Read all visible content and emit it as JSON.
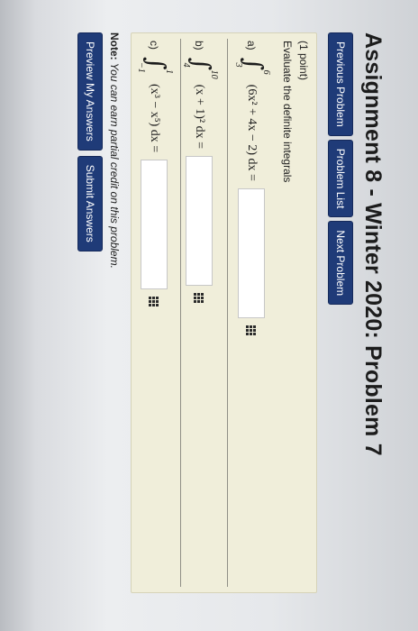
{
  "header": {
    "title": "Assignment 8 - Winter 2020: Problem 7"
  },
  "nav": {
    "prev_label": "Previous Problem",
    "list_label": "Problem List",
    "next_label": "Next Problem"
  },
  "problem": {
    "points": "(1 point)",
    "instructions": "Evaluate the definite integrals",
    "parts": [
      {
        "label": "a)",
        "upper": "6",
        "lower": "3",
        "integrand": "(6x² + 4x − 2) dx ="
      },
      {
        "label": "b)",
        "upper": "10",
        "lower": "4",
        "integrand": "(x + 1)² dx ="
      },
      {
        "label": "c)",
        "upper": "1",
        "lower": "−1",
        "integrand": "(x³ − x⁵) dx ="
      }
    ]
  },
  "note": {
    "bold": "Note:",
    "text": "You can earn partial credit on this problem."
  },
  "actions": {
    "preview_label": "Preview My Answers",
    "submit_label": "Submit Answers"
  },
  "colors": {
    "button_bg": "#1f3b78",
    "problem_bg": "#f0eeda"
  },
  "icons": {
    "answer_tool": "keypad-icon"
  }
}
